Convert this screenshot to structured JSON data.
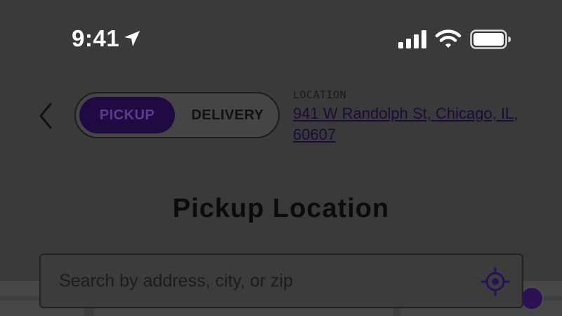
{
  "status_bar": {
    "time": "9:41",
    "icons": [
      "location-arrow-icon",
      "signal-icon",
      "wifi-icon",
      "battery-icon"
    ]
  },
  "header": {
    "back_icon": "chevron-left-icon",
    "toggle": {
      "pickup_label": "PICKUP",
      "delivery_label": "DELIVERY",
      "selected": "PICKUP"
    },
    "location": {
      "caption": "LOCATION",
      "address": "941 W Randolph St, Chicago, IL, 60607"
    }
  },
  "main": {
    "title": "Pickup Location",
    "search": {
      "placeholder": "Search by address, city, or zip",
      "value": "",
      "locate_icon": "crosshair-icon"
    }
  },
  "colors": {
    "accent": "#200a42",
    "overlay_background": "#3a3a3a",
    "status_text": "#ffffff"
  }
}
